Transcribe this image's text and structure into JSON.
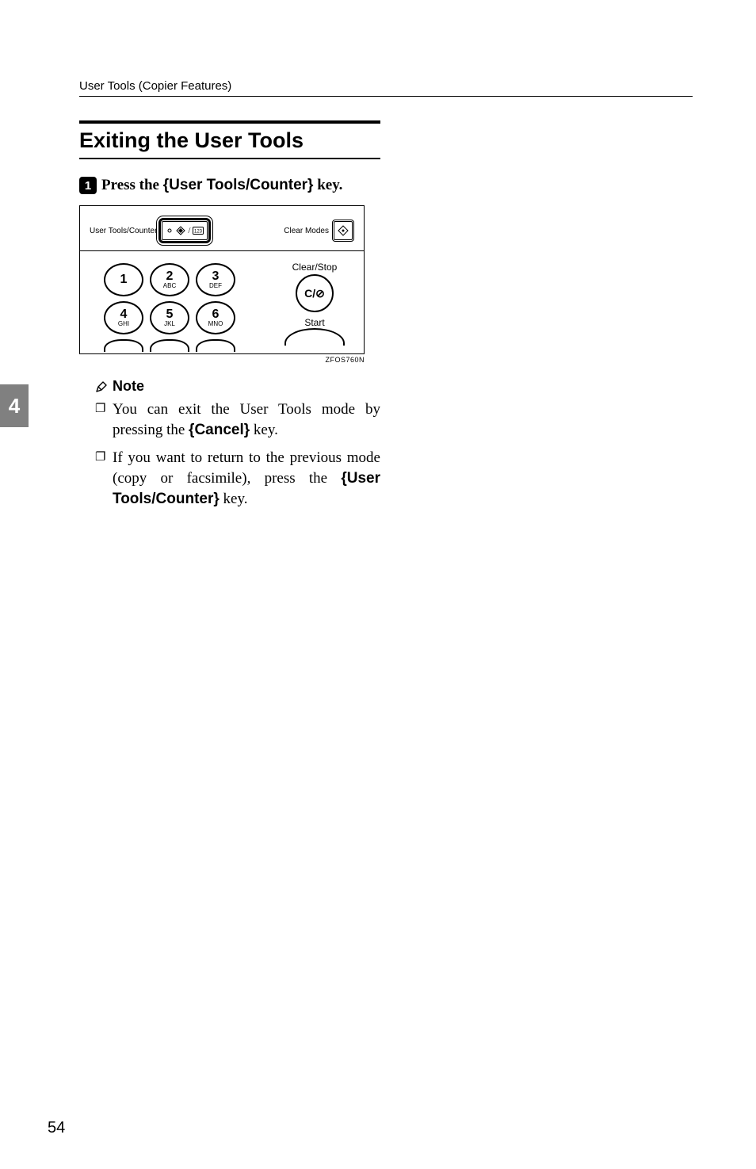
{
  "header": {
    "running": "User Tools (Copier Features)"
  },
  "section": {
    "title": "Exiting the User Tools"
  },
  "step1": {
    "num": "1",
    "pre": "Press the ",
    "lb": "{",
    "btn": "User Tools/Counter",
    "rb": "}",
    "post": " key."
  },
  "illus": {
    "user_tools_label": "User Tools/Counter",
    "clear_modes_label": "Clear Modes",
    "clear_stop_label": "Clear/Stop",
    "clear_stop_symbol": "C/⊘",
    "start_label": "Start",
    "caption": "ZFOS760N",
    "keys": [
      {
        "num": "1",
        "sub": ""
      },
      {
        "num": "2",
        "sub": "ABC"
      },
      {
        "num": "3",
        "sub": "DEF"
      },
      {
        "num": "4",
        "sub": "GHI"
      },
      {
        "num": "5",
        "sub": "JKL"
      },
      {
        "num": "6",
        "sub": "MNO"
      }
    ]
  },
  "note": {
    "heading": "Note",
    "item1_a": "You can exit the User Tools mode by pressing the ",
    "item1_lb": "{",
    "item1_btn": "Cancel",
    "item1_rb": "}",
    "item1_b": " key.",
    "item2_a": "If you want to return to the previous mode (copy or facsimile), press the ",
    "item2_lb": "{",
    "item2_btn": "User Tools/Counter",
    "item2_rb": "}",
    "item2_b": " key."
  },
  "sidetab": "4",
  "page_number": "54"
}
